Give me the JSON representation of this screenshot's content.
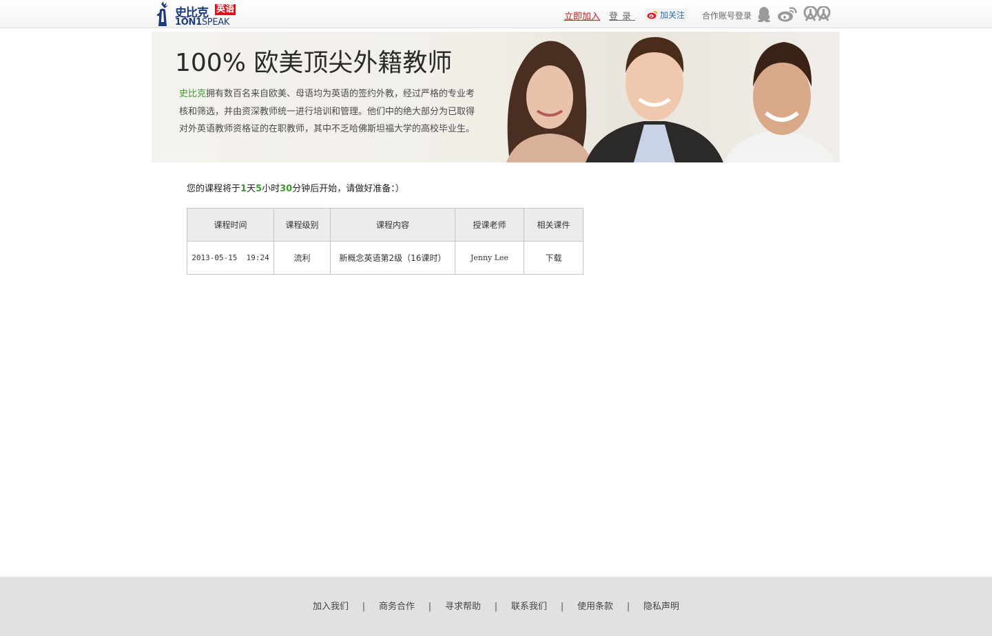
{
  "header": {
    "logo_cn": "史比克",
    "logo_cn_accent": "英语",
    "logo_en_bold": "1ON1",
    "logo_en_light": "SPEAK",
    "join_label": "立即加入",
    "login_label": "登录",
    "follow_label": "加关注",
    "partner_login_label": "合作账号登录",
    "social_icons": [
      "qq-icon",
      "weibo-icon",
      "renren-icon"
    ]
  },
  "banner": {
    "title": "100% 欧美顶尖外籍教师",
    "brand": "史比克",
    "description": "拥有数百名来自欧美、母语均为英语的签约外教，经过严格的专业考核和筛选，并由资深教师统一进行培训和管理。他们中的绝大部分为已取得对外英语教师资格证的在职教师，其中不乏哈佛斯坦福大学的高校毕业生。"
  },
  "countdown": {
    "prefix": "您的课程将于",
    "days": "1",
    "days_unit": "天",
    "hours": "5",
    "hours_unit": "小时",
    "minutes": "30",
    "suffix": "分钟后开始，请做好准备：）"
  },
  "course_table": {
    "headers": [
      "课程时间",
      "课程级别",
      "课程内容",
      "授课老师",
      "相关课件"
    ],
    "rows": [
      {
        "time": "2013-05-15  19:24",
        "level": "流利",
        "content": "新概念英语第2级（16课时）",
        "teacher": "Jenny Lee",
        "download": "下载"
      }
    ]
  },
  "footer": {
    "links": [
      "加入我们",
      "商务合作",
      "寻求帮助",
      "联系我们",
      "使用条款",
      "隐私声明"
    ],
    "separator": "|"
  },
  "colors": {
    "brand_green": "#3b9a2b",
    "brand_red": "#c8151c",
    "brand_blue": "#1c3c7c",
    "footer_bg": "#e1e1e1"
  }
}
